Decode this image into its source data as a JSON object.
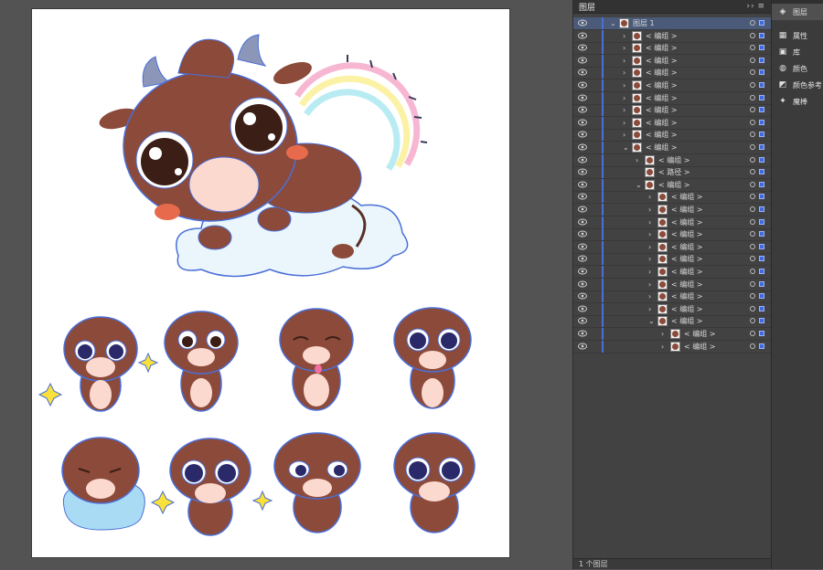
{
  "layers_panel": {
    "title": "图层",
    "collapse": "››",
    "menu": "≡",
    "footer": "1 个图层",
    "rows": [
      {
        "label": "图层 1",
        "depth": 0,
        "expanded": true,
        "selected": true
      },
      {
        "label": "< 编组 >",
        "depth": 1,
        "expanded": false
      },
      {
        "label": "< 编组 >",
        "depth": 1,
        "expanded": false
      },
      {
        "label": "< 编组 >",
        "depth": 1,
        "expanded": false
      },
      {
        "label": "< 编组 >",
        "depth": 1,
        "expanded": false
      },
      {
        "label": "< 编组 >",
        "depth": 1,
        "expanded": false
      },
      {
        "label": "< 编组 >",
        "depth": 1,
        "expanded": false
      },
      {
        "label": "< 编组 >",
        "depth": 1,
        "expanded": false
      },
      {
        "label": "< 编组 >",
        "depth": 1,
        "expanded": false
      },
      {
        "label": "< 编组 >",
        "depth": 1,
        "expanded": false
      },
      {
        "label": "< 编组 >",
        "depth": 1,
        "expanded": true
      },
      {
        "label": "< 编组 >",
        "depth": 2,
        "expanded": false
      },
      {
        "label": "< 路径 >",
        "depth": 2,
        "expanded": null
      },
      {
        "label": "< 编组 >",
        "depth": 2,
        "expanded": true
      },
      {
        "label": "< 编组 >",
        "depth": 3,
        "expanded": false
      },
      {
        "label": "< 编组 >",
        "depth": 3,
        "expanded": false
      },
      {
        "label": "< 编组 >",
        "depth": 3,
        "expanded": false
      },
      {
        "label": "< 编组 >",
        "depth": 3,
        "expanded": false
      },
      {
        "label": "< 编组 >",
        "depth": 3,
        "expanded": false
      },
      {
        "label": "< 编组 >",
        "depth": 3,
        "expanded": false
      },
      {
        "label": "< 编组 >",
        "depth": 3,
        "expanded": false
      },
      {
        "label": "< 编组 >",
        "depth": 3,
        "expanded": false
      },
      {
        "label": "< 编组 >",
        "depth": 3,
        "expanded": false
      },
      {
        "label": "< 编组 >",
        "depth": 3,
        "expanded": false
      },
      {
        "label": "< 编组 >",
        "depth": 3,
        "expanded": true
      },
      {
        "label": "< 编组 >",
        "depth": 4,
        "expanded": false
      },
      {
        "label": "< 编组 >",
        "depth": 4,
        "expanded": false
      }
    ]
  },
  "side_panel": {
    "items": [
      {
        "label": "图层",
        "icon": "layers-icon",
        "active": true
      },
      {
        "label": "属性",
        "icon": "properties-icon",
        "active": false
      },
      {
        "label": "库",
        "icon": "libraries-icon",
        "active": false
      },
      {
        "label": "颜色",
        "icon": "color-icon",
        "active": false
      },
      {
        "label": "颜色参考",
        "icon": "color-guide-icon",
        "active": false
      },
      {
        "label": "魔棒",
        "icon": "magic-wand-icon",
        "active": false
      }
    ]
  },
  "colors": {
    "workspace": "#535353",
    "panel": "#424242",
    "selection": "#3e6ae0",
    "cow_brown": "#8b4a3a",
    "cow_muzzle": "#fbd9cf",
    "path_blue": "#4b6fd8"
  }
}
